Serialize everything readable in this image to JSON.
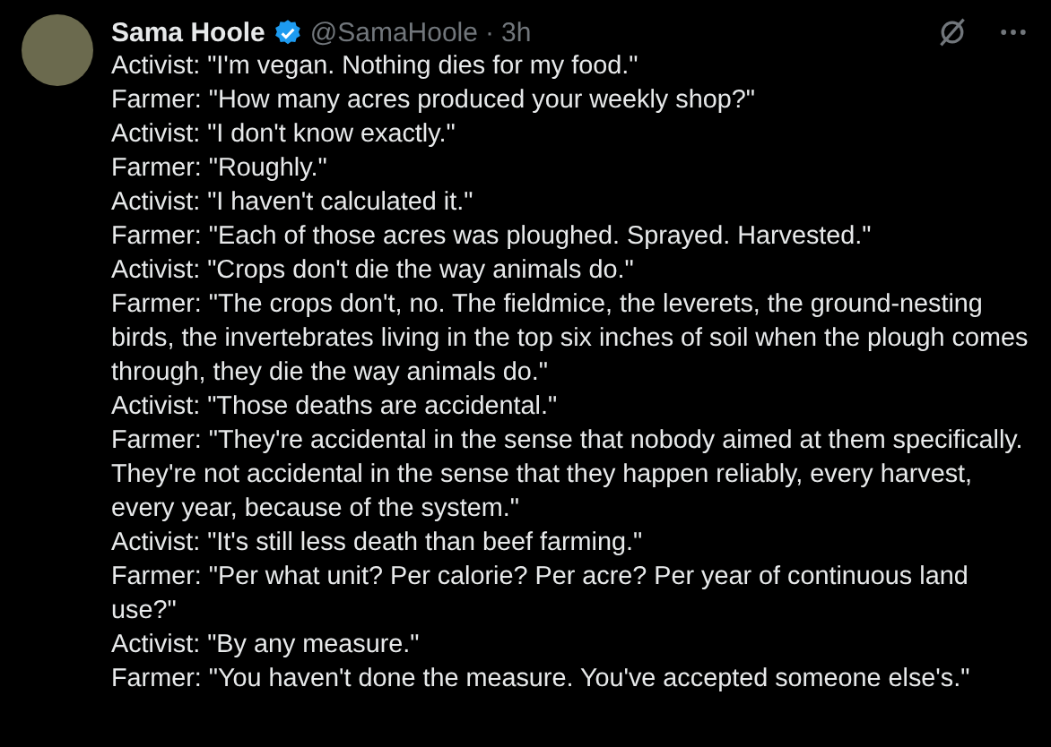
{
  "post": {
    "author": "Sama Hoole",
    "verified": true,
    "handle": "@SamaHoole",
    "separator": "·",
    "time": "3h",
    "lines": [
      "Activist: \"I'm vegan. Nothing dies for my food.\"",
      "Farmer: \"How many acres produced your weekly shop?\"",
      "Activist: \"I don't know exactly.\"",
      "Farmer: \"Roughly.\"",
      "Activist: \"I haven't calculated it.\"",
      "Farmer: \"Each of those acres was ploughed. Sprayed. Harvested.\"",
      "Activist: \"Crops don't die the way animals do.\"",
      "Farmer: \"The crops don't, no. The fieldmice, the leverets, the ground-nesting birds, the invertebrates living in the top six inches of soil when the plough comes through, they die the way animals do.\"",
      "Activist: \"Those deaths are accidental.\"",
      "Farmer: \"They're accidental in the sense that nobody aimed at them specifically. They're not accidental in the sense that they happen reliably, every harvest, every year, because of the system.\"",
      "Activist: \"It's still less death than beef farming.\"",
      "Farmer: \"Per what unit? Per calorie? Per acre? Per year of continuous land use?\"",
      "Activist: \"By any measure.\"",
      "Farmer: \"You haven't done the measure. You've accepted someone else's.\""
    ]
  }
}
